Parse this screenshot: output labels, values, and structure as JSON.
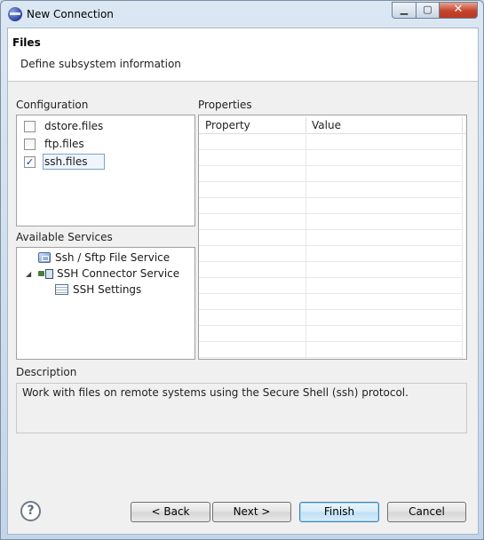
{
  "window": {
    "title": "New Connection",
    "controls": {
      "minimize": "▁",
      "maximize": "▢",
      "close": "✕"
    }
  },
  "header": {
    "title": "Files",
    "description": "Define subsystem information"
  },
  "configuration": {
    "label": "Configuration",
    "items": [
      {
        "label": "dstore.files",
        "checked": false,
        "mark": ""
      },
      {
        "label": "ftp.files",
        "checked": false,
        "mark": ""
      },
      {
        "label": "ssh.files",
        "checked": true,
        "mark": "✓"
      }
    ]
  },
  "available_services": {
    "label": "Available Services",
    "items": [
      {
        "label": "Ssh / Sftp File Service",
        "icon": "file-service-icon",
        "expandable": false
      },
      {
        "label": "SSH Connector Service",
        "icon": "connector-service-icon",
        "expandable": true,
        "expanded": true,
        "arrow": "◢"
      },
      {
        "label": "SSH Settings",
        "icon": "settings-table-icon",
        "expandable": false
      }
    ]
  },
  "properties": {
    "label": "Properties",
    "columns": [
      "Property",
      "Value"
    ],
    "rows": []
  },
  "description": {
    "label": "Description",
    "text": "Work with files on remote systems using the Secure Shell (ssh) protocol."
  },
  "footer": {
    "help": "?",
    "back": "< Back",
    "next": "Next >",
    "finish": "Finish",
    "cancel": "Cancel"
  }
}
